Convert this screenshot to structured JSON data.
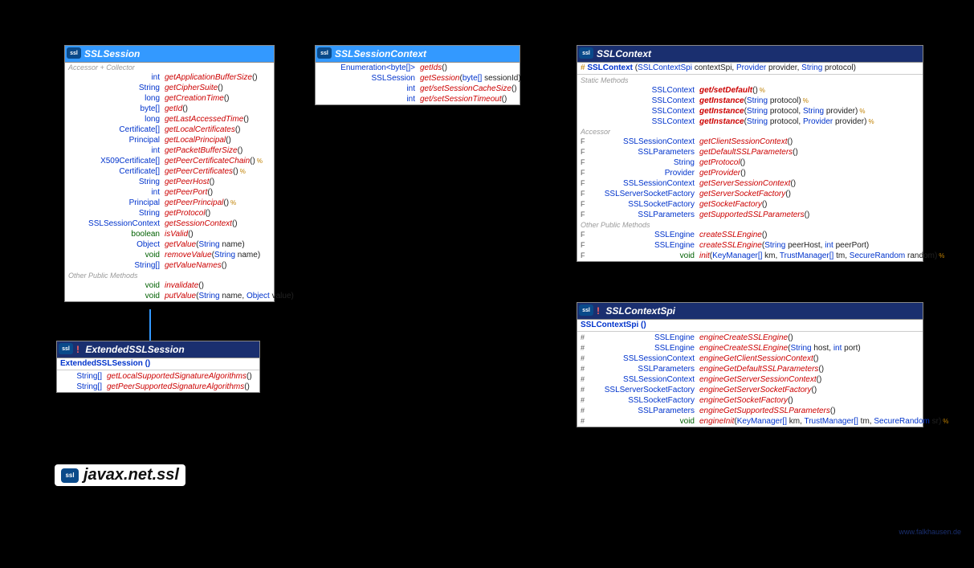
{
  "package": "javax.net.ssl",
  "watermark": "www.falkhausen.de",
  "sslSession": {
    "title": "SSLSession",
    "sections": {
      "accessor": "Accessor + Collector",
      "other": "Other Public Methods"
    },
    "rows": [
      {
        "t": "int",
        "n": "getApplicationBufferSize",
        "p": "()"
      },
      {
        "t": "String",
        "n": "getCipherSuite",
        "p": "()"
      },
      {
        "t": "long",
        "n": "getCreationTime",
        "p": "()"
      },
      {
        "t": "byte[]",
        "n": "getId",
        "p": "()"
      },
      {
        "t": "long",
        "n": "getLastAccessedTime",
        "p": "()"
      },
      {
        "t": "Certificate[]",
        "n": "getLocalCertificates",
        "p": "()"
      },
      {
        "t": "Principal",
        "n": "getLocalPrincipal",
        "p": "()"
      },
      {
        "t": "int",
        "n": "getPacketBufferSize",
        "p": "()"
      },
      {
        "t": "X509Certificate[]",
        "n": "getPeerCertificateChain",
        "p": "()",
        "f": "%"
      },
      {
        "t": "Certificate[]",
        "n": "getPeerCertificates",
        "p": "()",
        "f": "%"
      },
      {
        "t": "String",
        "n": "getPeerHost",
        "p": "()"
      },
      {
        "t": "int",
        "n": "getPeerPort",
        "p": "()"
      },
      {
        "t": "Principal",
        "n": "getPeerPrincipal",
        "p": "()",
        "f": "%"
      },
      {
        "t": "String",
        "n": "getProtocol",
        "p": "()"
      },
      {
        "t": "SSLSessionContext",
        "n": "getSessionContext",
        "p": "()"
      },
      {
        "t": "boolean",
        "n": "isValid",
        "p": "()",
        "kw": true
      },
      {
        "t": "Object",
        "n": "getValue",
        "p": "(String name)"
      },
      {
        "t": "void",
        "n": "removeValue",
        "p": "(String name)",
        "kw": true
      },
      {
        "t": "String[]",
        "n": "getValueNames",
        "p": "()"
      }
    ],
    "other": [
      {
        "t": "void",
        "n": "invalidate",
        "p": "()",
        "kw": true
      },
      {
        "t": "void",
        "n": "putValue",
        "p": "(String name, Object value)",
        "kw": true
      }
    ]
  },
  "sslSessionContext": {
    "title": "SSLSessionContext",
    "rows": [
      {
        "t": "Enumeration<byte[]>",
        "n": "getIds",
        "p": "()"
      },
      {
        "t": "SSLSession",
        "n": "getSession",
        "p": "(byte[] sessionId)"
      },
      {
        "t": "int",
        "n": "get/setSessionCacheSize",
        "p": "()"
      },
      {
        "t": "int",
        "n": "get/setSessionTimeout",
        "p": "()"
      }
    ]
  },
  "extSession": {
    "title": "ExtendedSSLSession",
    "ctor": "ExtendedSSLSession ()",
    "rows": [
      {
        "t": "String[]",
        "n": "getLocalSupportedSignatureAlgorithms",
        "p": "()"
      },
      {
        "t": "String[]",
        "n": "getPeerSupportedSignatureAlgorithms",
        "p": "()"
      }
    ]
  },
  "sslContext": {
    "title": "SSLContext",
    "ctor_pre": "# ",
    "ctor": "SSLContext",
    "ctor_p": " (SSLContextSpi contextSpi, Provider provider, String protocol)",
    "sections": {
      "static": "Static Methods",
      "accessor": "Accessor",
      "other": "Other Public Methods"
    },
    "staticRows": [
      {
        "t": "SSLContext",
        "n": "get/setDefault",
        "p": "()",
        "f": "%",
        "b": true
      },
      {
        "t": "SSLContext",
        "n": "getInstance",
        "p": "(String protocol)",
        "f": "%",
        "b": true
      },
      {
        "t": "SSLContext",
        "n": "getInstance",
        "p": "(String protocol, String provider)",
        "f": "%",
        "b": true
      },
      {
        "t": "SSLContext",
        "n": "getInstance",
        "p": "(String protocol, Provider provider)",
        "f": "%",
        "b": true
      }
    ],
    "accRows": [
      {
        "m": "F",
        "t": "SSLSessionContext",
        "n": "getClientSessionContext",
        "p": "()"
      },
      {
        "m": "F",
        "t": "SSLParameters",
        "n": "getDefaultSSLParameters",
        "p": "()"
      },
      {
        "m": "F",
        "t": "String",
        "n": "getProtocol",
        "p": "()"
      },
      {
        "m": "F",
        "t": "Provider",
        "n": "getProvider",
        "p": "()"
      },
      {
        "m": "F",
        "t": "SSLSessionContext",
        "n": "getServerSessionContext",
        "p": "()"
      },
      {
        "m": "F",
        "t": "SSLServerSocketFactory",
        "n": "getServerSocketFactory",
        "p": "()"
      },
      {
        "m": "F",
        "t": "SSLSocketFactory",
        "n": "getSocketFactory",
        "p": "()"
      },
      {
        "m": "F",
        "t": "SSLParameters",
        "n": "getSupportedSSLParameters",
        "p": "()"
      }
    ],
    "otherRows": [
      {
        "m": "F",
        "t": "SSLEngine",
        "n": "createSSLEngine",
        "p": "()"
      },
      {
        "m": "F",
        "t": "SSLEngine",
        "n": "createSSLEngine",
        "p": "(String peerHost, int peerPort)"
      },
      {
        "m": "F",
        "t": "void",
        "n": "init",
        "p": "(KeyManager[] km, TrustManager[] tm, SecureRandom random)",
        "f": "%",
        "kw": true
      }
    ]
  },
  "sslContextSpi": {
    "title": "SSLContextSpi",
    "ctor": "SSLContextSpi ()",
    "rows": [
      {
        "m": "#",
        "t": "SSLEngine",
        "n": "engineCreateSSLEngine",
        "p": "()"
      },
      {
        "m": "#",
        "t": "SSLEngine",
        "n": "engineCreateSSLEngine",
        "p": "(String host, int port)"
      },
      {
        "m": "#",
        "t": "SSLSessionContext",
        "n": "engineGetClientSessionContext",
        "p": "()"
      },
      {
        "m": "#",
        "t": "SSLParameters",
        "n": "engineGetDefaultSSLParameters",
        "p": "()"
      },
      {
        "m": "#",
        "t": "SSLSessionContext",
        "n": "engineGetServerSessionContext",
        "p": "()"
      },
      {
        "m": "#",
        "t": "SSLServerSocketFactory",
        "n": "engineGetServerSocketFactory",
        "p": "()"
      },
      {
        "m": "#",
        "t": "SSLSocketFactory",
        "n": "engineGetSocketFactory",
        "p": "()"
      },
      {
        "m": "#",
        "t": "SSLParameters",
        "n": "engineGetSupportedSSLParameters",
        "p": "()"
      },
      {
        "m": "#",
        "t": "void",
        "n": "engineInit",
        "p": "(KeyManager[] km, TrustManager[] tm, SecureRandom sr)",
        "f": "%",
        "kw": true
      }
    ]
  }
}
